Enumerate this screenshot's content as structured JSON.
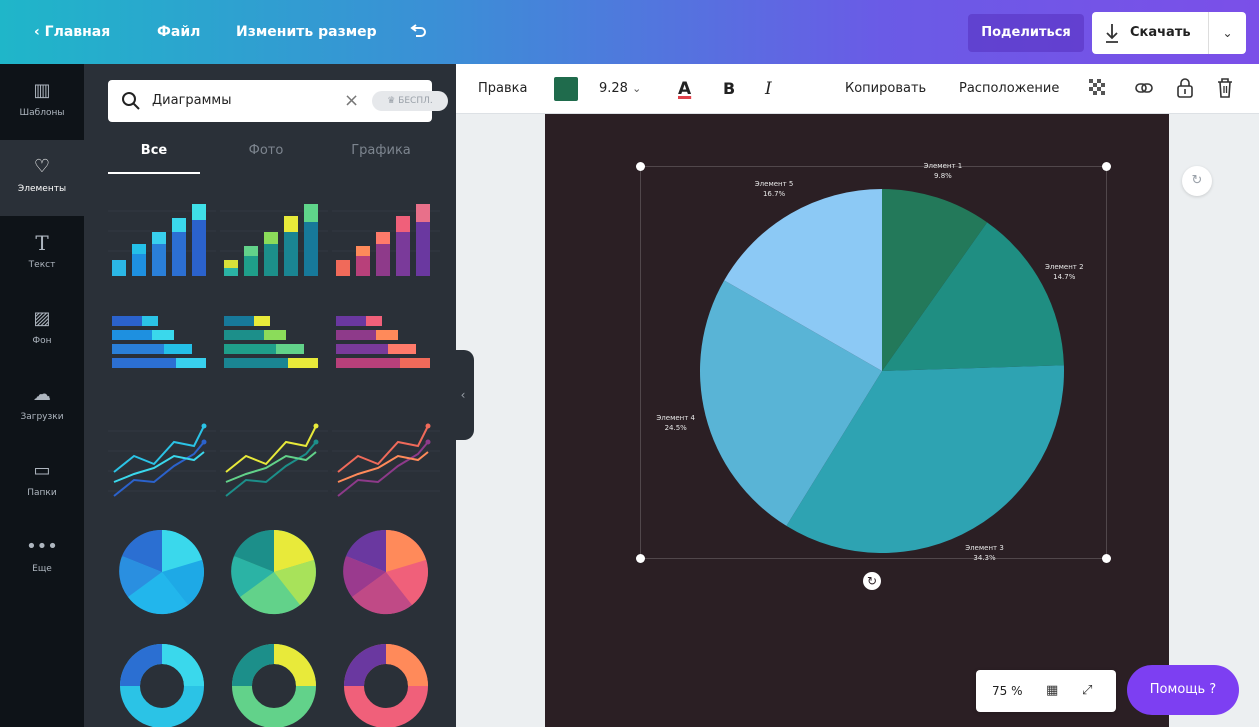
{
  "topbar": {
    "home": "Главная",
    "file": "Файл",
    "resize": "Изменить размер",
    "undo_icon": "undo-icon",
    "share": "Поделиться",
    "download": "Скачать"
  },
  "rail": {
    "templates": "Шаблоны",
    "elements": "Элементы",
    "text": "Текст",
    "background": "Фон",
    "uploads": "Загрузки",
    "folders": "Папки",
    "more": "Еще"
  },
  "panel": {
    "search_value": "Диаграммы",
    "badge": "♛ БЕСПЛ.",
    "tabs": [
      "Все",
      "Фото",
      "Графика"
    ]
  },
  "toolbar": {
    "edit": "Правка",
    "color": "#1f6b4c",
    "font_size": "9.28",
    "copy": "Копировать",
    "arrange": "Расположение"
  },
  "chart_data": {
    "type": "pie",
    "labels": [
      "Элемент 1",
      "Элемент 2",
      "Элемент 3",
      "Элемент 4",
      "Элемент 5"
    ],
    "values": [
      9.8,
      14.7,
      34.3,
      24.5,
      16.7
    ],
    "value_labels": [
      "9.8%",
      "14.7%",
      "34.3%",
      "24.5%",
      "16.7%"
    ],
    "colors": [
      "#23795a",
      "#1f8e82",
      "#2ea3b2",
      "#59b4d6",
      "#8cc9f5"
    ]
  },
  "bottom": {
    "zoom": "75 %",
    "help": "Помощь ?"
  }
}
